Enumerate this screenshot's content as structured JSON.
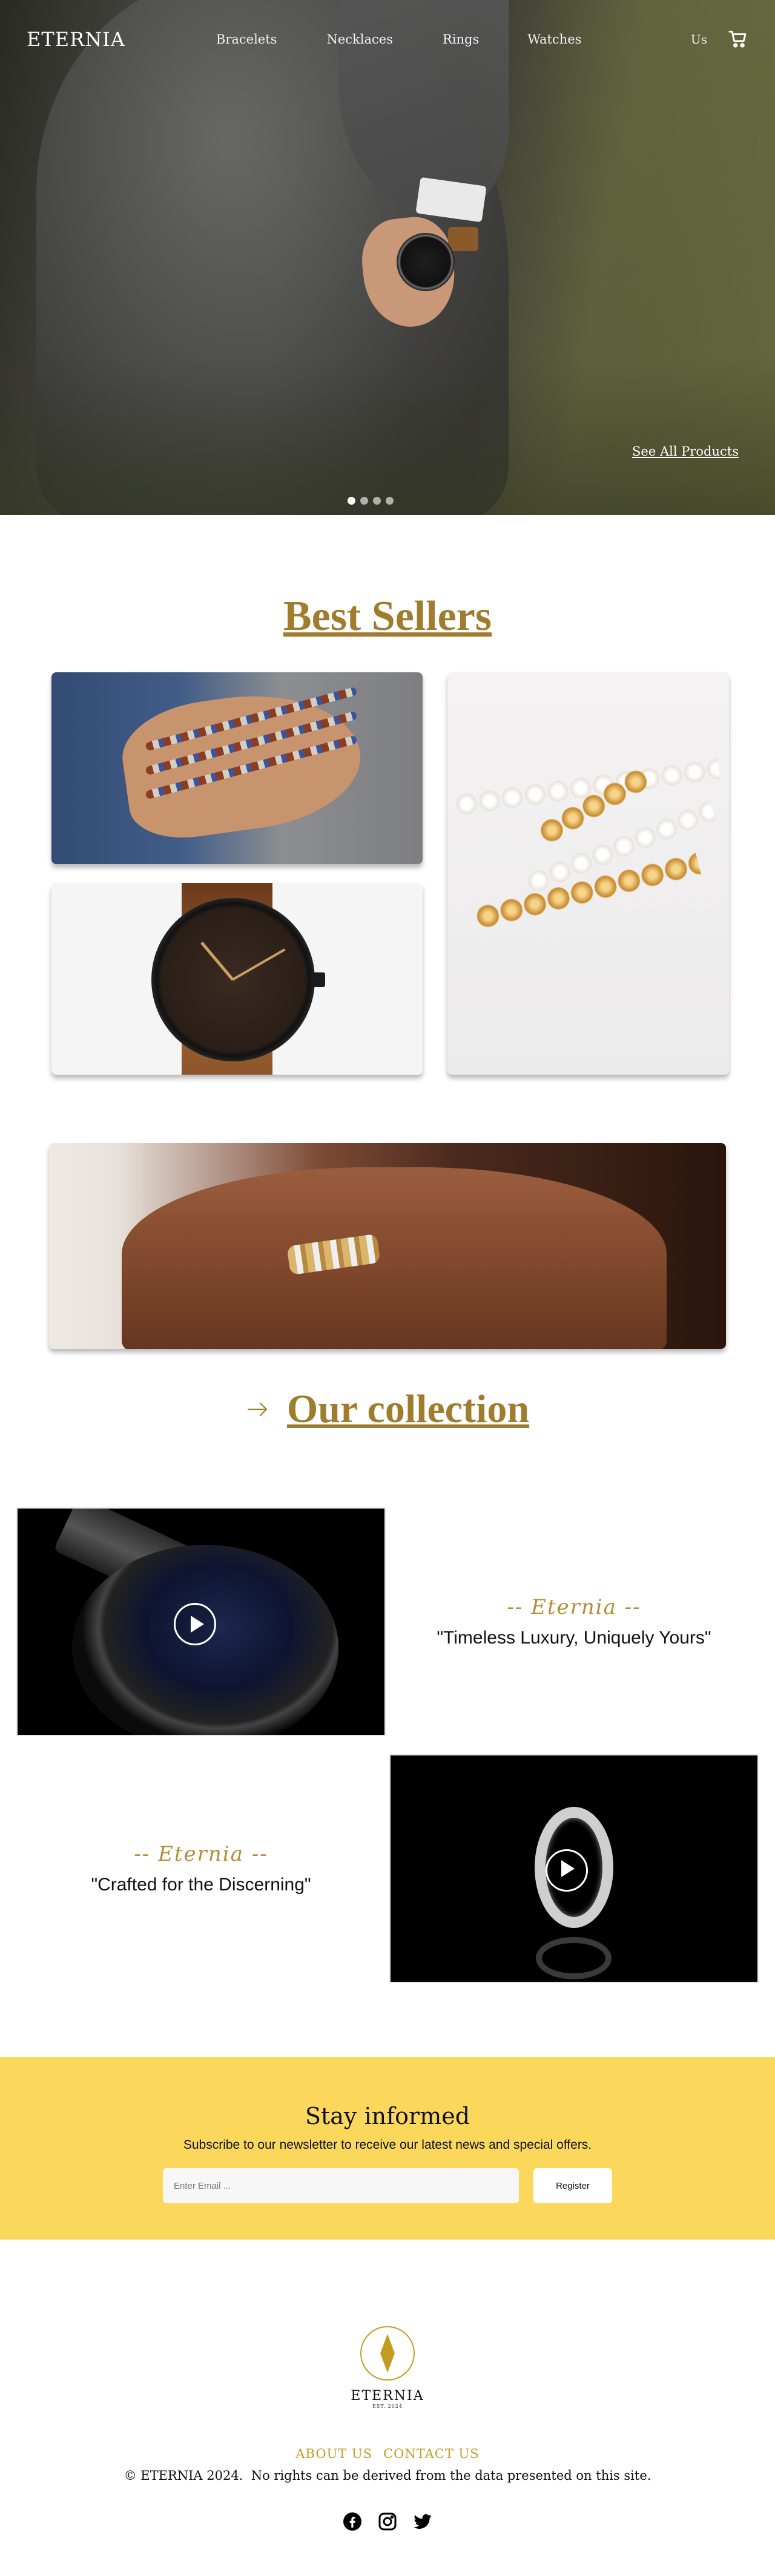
{
  "header": {
    "logo": "ETERNIA",
    "nav": [
      "Bracelets",
      "Necklaces",
      "Rings",
      "Watches"
    ],
    "lang": "Us",
    "cart_icon": "cart-icon"
  },
  "hero": {
    "cta": "See All Products",
    "slide_count": 4,
    "active_slide": 1
  },
  "best_sellers": {
    "title": "Best Sellers",
    "products": [
      "bracelets",
      "pearl-gold-bracelet",
      "watch",
      "ring"
    ]
  },
  "collection": {
    "title": "Our collection",
    "arrow_icon": "arrow-right-icon"
  },
  "videos": [
    {
      "brand": "-- Eternia --",
      "tagline": "\"Timeless Luxury, Uniquely Yours\""
    },
    {
      "brand": "-- Eternia --",
      "tagline": "\"Crafted for the Discerning\""
    }
  ],
  "newsletter": {
    "title": "Stay informed",
    "subtitle": "Subscribe to our newsletter to receive our latest news and special offers.",
    "placeholder": "Enter Email ...",
    "button": "Register"
  },
  "footer": {
    "logo": "ETERNIA",
    "est": "EST. 2024",
    "links": [
      "ABOUT US",
      "CONTACT US"
    ],
    "copyright": "© ETERNIA 2024.  No rights can be derived from the data presented on this site.",
    "social": [
      "facebook-icon",
      "instagram-icon",
      "twitter-icon"
    ]
  },
  "colors": {
    "gold": "#a07d2e",
    "newsletter_bg": "#fbd75c",
    "footer_link": "#c39c24"
  }
}
